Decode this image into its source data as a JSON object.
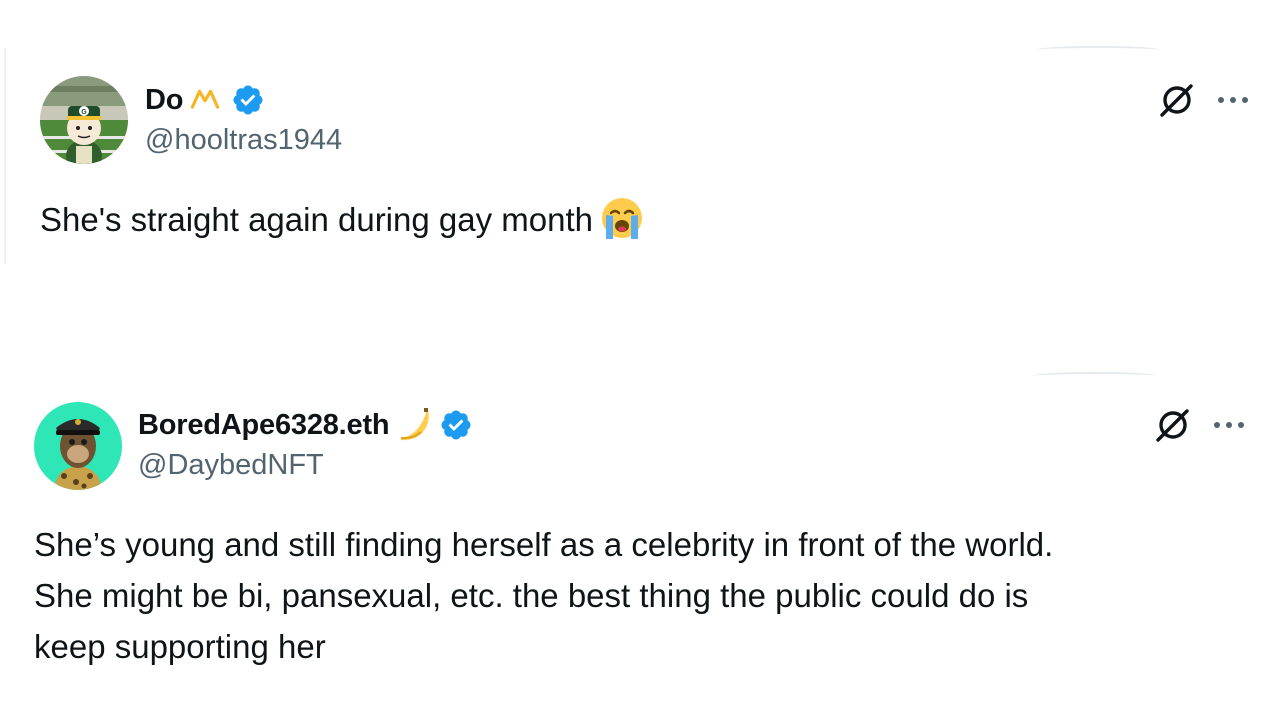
{
  "tweets": [
    {
      "display_name": "Do",
      "name_mark_icon": "gold-m-logo",
      "verified": true,
      "handle": "@hooltras1944",
      "text": "She's straight again during gay month",
      "text_emoji": "loudly-crying-face-emoji",
      "avatar_icon": "green-bay-fan-avatar"
    },
    {
      "display_name": "BoredApe6328.eth",
      "name_mark_icon": "banana-emoji",
      "verified": true,
      "handle": "@DaybedNFT",
      "text_lines": [
        "She’s young and still finding herself as a celebrity in front of the world.",
        "She might be bi, pansexual, etc. the best thing the public could do is",
        "keep supporting her"
      ],
      "avatar_icon": "bored-ape-avatar"
    }
  ],
  "colors": {
    "verified_blue": "#1d9bf0",
    "handle_gray": "#536471",
    "text": "#0f1419",
    "avatar_mint": "#2fe6b6"
  }
}
